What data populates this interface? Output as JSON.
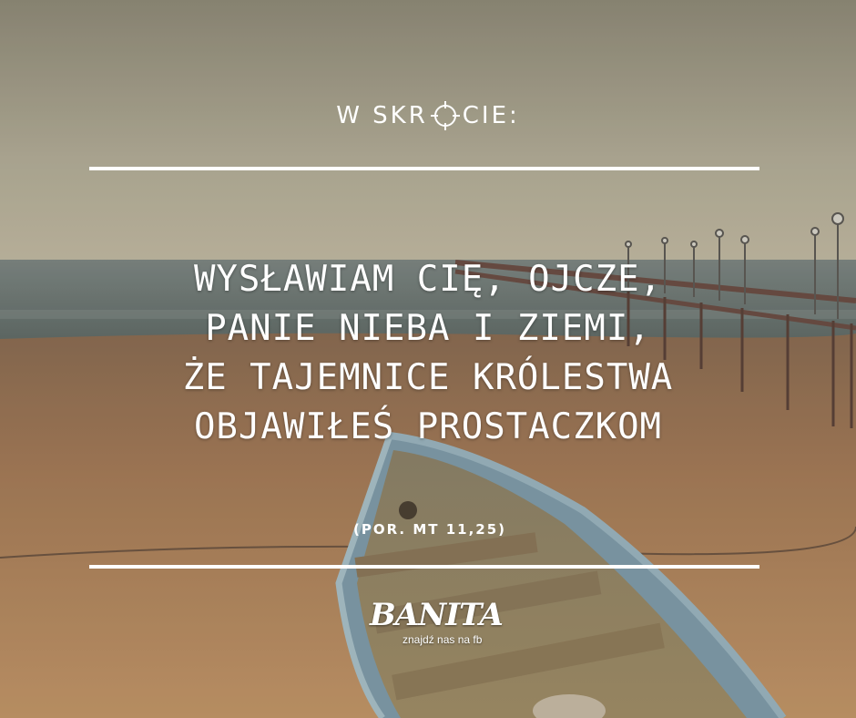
{
  "header": {
    "word_before": "W SKR",
    "word_after": "CIE:",
    "icon": "crosshair-icon"
  },
  "quote": {
    "lines": [
      "WYSŁAWIAM CIĘ, OJCZE,",
      "PANIE NIEBA I ZIEMI,",
      "ŻE TAJEMNICE KRÓLESTWA",
      "OBJAWIŁEŚ PROSTACZKOM"
    ]
  },
  "reference": "(POR. MT 11,25)",
  "logo": {
    "brand": "BANITA",
    "tagline": "znajdź nas na fb"
  },
  "colors": {
    "text": "#ffffff",
    "sky": "#a9a48f",
    "sea": "#6f7b78",
    "sand": "#b98d62",
    "boat": "#7a9aa8"
  }
}
